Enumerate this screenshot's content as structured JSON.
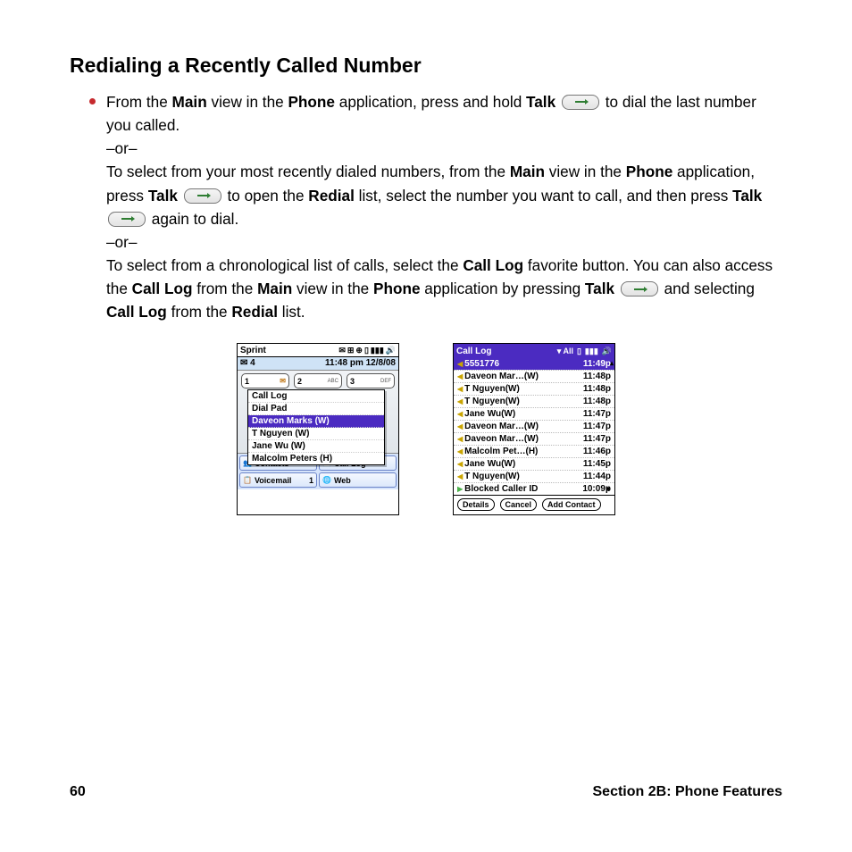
{
  "heading": "Redialing a Recently Called Number",
  "para": {
    "p1a": "From the ",
    "p1b": "Main",
    "p1c": " view in the ",
    "p1d": "Phone",
    "p1e": " application, press and hold ",
    "p1f": "Talk",
    "p1g": " to dial the last number you called.",
    "or": "–or–",
    "p2a": "To select from your most recently dialed numbers, from the ",
    "p2b": "Main",
    "p2c": " view in the ",
    "p2d": "Phone",
    "p2e": " application, press ",
    "p2f": "Talk",
    "p2g": " to open the ",
    "p2h": "Redial",
    "p2i": " list, select the number you want to call, and then press ",
    "p2j": "Talk",
    "p2k": " again to dial.",
    "p3a": "To select from a chronological list of calls, select the ",
    "p3b": "Call Log",
    "p3c": " favorite button. You can also access the ",
    "p3d": "Call Log",
    "p3e": " from the ",
    "p3f": "Main",
    "p3g": " view in the ",
    "p3h": "Phone",
    "p3i": " application by pressing ",
    "p3j": "Talk",
    "p3k": " and selecting ",
    "p3l": "Call Log",
    "p3m": " from the ",
    "p3n": "Redial",
    "p3o": " list."
  },
  "screen1": {
    "carrier": "Sprint",
    "msg_count": "4",
    "time": "11:48 pm",
    "date": "12/8/08",
    "digits": [
      {
        "num": "1",
        "sub": "",
        "env": "✉"
      },
      {
        "num": "2",
        "sub": "ABC",
        "env": ""
      },
      {
        "num": "3",
        "sub": "DEF",
        "env": ""
      }
    ],
    "popup": [
      "Call Log",
      "Dial Pad",
      "Daveon Marks (W)",
      "T Nguyen (W)",
      "Jane Wu (W)",
      "Malcolm Peters (H)"
    ],
    "popup_selected_index": 2,
    "favorites": [
      {
        "icon": "👥",
        "label": "Contacts"
      },
      {
        "icon": "📄",
        "label": "Call Log"
      },
      {
        "icon": "📋",
        "label": "Voicemail",
        "badge": "1"
      },
      {
        "icon": "🌐",
        "label": "Web"
      }
    ]
  },
  "screen2": {
    "title": "Call Log",
    "filter": "All",
    "rows": [
      {
        "dir": "out",
        "name": "5551776",
        "time": "11:49p",
        "sel": true
      },
      {
        "dir": "out",
        "name": "Daveon Mar…(W)",
        "time": "11:48p"
      },
      {
        "dir": "out",
        "name": "T Nguyen(W)",
        "time": "11:48p"
      },
      {
        "dir": "out",
        "name": "T Nguyen(W)",
        "time": "11:48p"
      },
      {
        "dir": "out",
        "name": "Jane Wu(W)",
        "time": "11:47p"
      },
      {
        "dir": "out",
        "name": "Daveon Mar…(W)",
        "time": "11:47p"
      },
      {
        "dir": "out",
        "name": "Daveon Mar…(W)",
        "time": "11:47p"
      },
      {
        "dir": "out",
        "name": "Malcolm Pet…(H)",
        "time": "11:46p"
      },
      {
        "dir": "out",
        "name": "Jane Wu(W)",
        "time": "11:45p"
      },
      {
        "dir": "out",
        "name": "T Nguyen(W)",
        "time": "11:44p"
      },
      {
        "dir": "in",
        "name": "Blocked Caller ID",
        "time": "10:09p"
      }
    ],
    "buttons": [
      "Details",
      "Cancel",
      "Add Contact"
    ]
  },
  "footer": {
    "page": "60",
    "section": "Section 2B: Phone Features"
  }
}
